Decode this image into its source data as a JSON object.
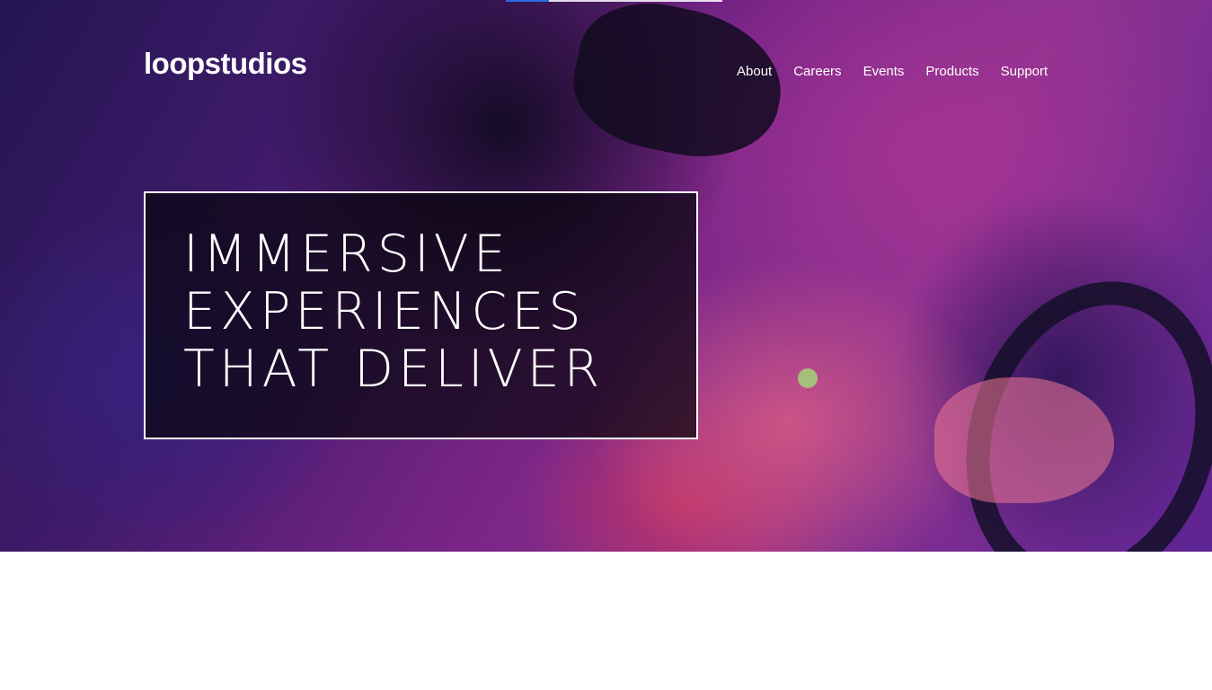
{
  "header": {
    "logo_text": "loopstudios",
    "nav": [
      {
        "label": "About"
      },
      {
        "label": "Careers"
      },
      {
        "label": "Events"
      },
      {
        "label": "Products"
      },
      {
        "label": "Support"
      }
    ]
  },
  "hero": {
    "headline": "IMMERSIVE\nEXPERIENCES\nTHAT DELIVER"
  },
  "colors": {
    "hero_tint": "#7a2a9c",
    "accent": "#2b6be0",
    "text": "#ffffff"
  }
}
